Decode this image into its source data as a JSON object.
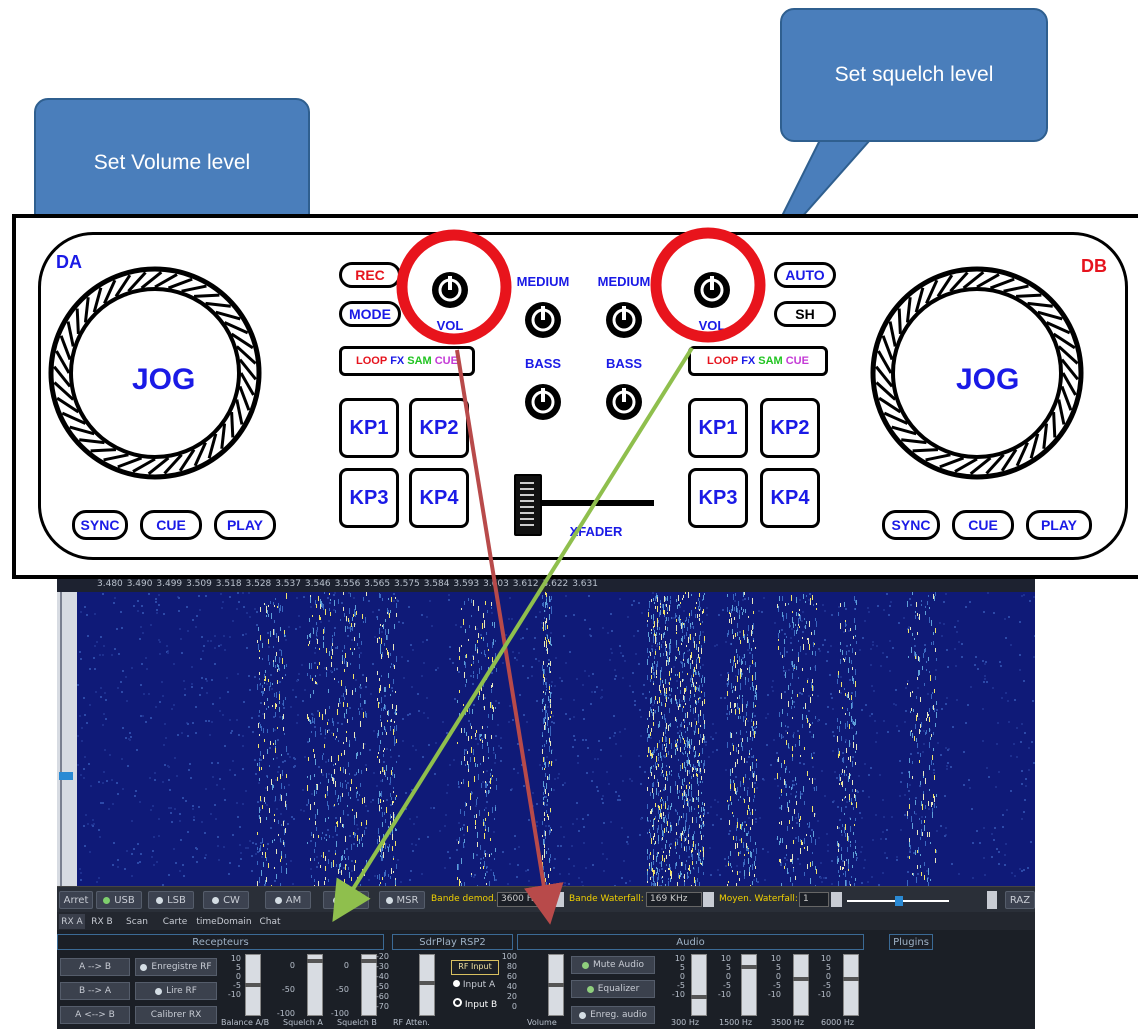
{
  "callouts": {
    "volume": "Set Volume level",
    "squelch": "Set squelch level"
  },
  "controller": {
    "deck_a": "DA",
    "deck_b": "DB",
    "jog": "JOG",
    "left_buttons": [
      "REC",
      "MODE"
    ],
    "right_buttons": [
      "AUTO",
      "SH"
    ],
    "vol": "VOL",
    "medium": "MEDIUM",
    "bass": "BASS",
    "loop": [
      "LOOP",
      "FX",
      "SAM",
      "CUE"
    ],
    "pads": [
      "KP1",
      "KP2",
      "KP3",
      "KP4"
    ],
    "bottom_buttons": [
      "SYNC",
      "CUE",
      "PLAY"
    ],
    "xfader": "XFADER",
    "colors": {
      "label": "#1a1ae6",
      "rec": "#e6141e",
      "db": "#e6141e",
      "fx": "#1a1ae6",
      "sam": "#21c421",
      "cue": "#c43ad6",
      "highlight_circle": "#e8141c",
      "arrow_red": "#b84a4a",
      "arrow_green": "#8fbf4d"
    }
  },
  "sdr": {
    "ruler_ticks": [
      "3.480",
      "3.490",
      "3.499",
      "3.509",
      "3.518",
      "3.528",
      "3.537",
      "3.546",
      "3.556",
      "3.565",
      "3.575",
      "3.584",
      "3.593",
      "3.603",
      "3.612",
      "3.622",
      "3.631"
    ],
    "mode_buttons": {
      "stop": "Arret",
      "usb": "USB",
      "lsb": "LSB",
      "cw": "CW",
      "am": "AM",
      "fm": "FM",
      "msr": "MSR"
    },
    "demod": {
      "label": "Bande demod.:",
      "value": "3600 Hz"
    },
    "waterfall_band": {
      "label": "Bande Waterfall:",
      "value": "169 KHz"
    },
    "waterfall_avg": {
      "label": "Moyen. Waterfall:",
      "value": "1"
    },
    "raz": "RAZ",
    "tabs": [
      "RX A",
      "RX B",
      "Scan",
      "Carte",
      "timeDomain",
      "Chat"
    ],
    "sections": {
      "receivers": "Recepteurs",
      "device": "SdrPlay RSP2",
      "audio": "Audio",
      "plugins": "Plugins"
    },
    "receiver_buttons": [
      "A --> B",
      "B --> A",
      "A <--> B"
    ],
    "rf_buttons": {
      "record": "Enregistre RF",
      "read": "Lire RF",
      "calibrate": "Calibrer RX"
    },
    "rf_input": {
      "title": "RF Input",
      "a": "Input A",
      "b": "Input B"
    },
    "audio_buttons": {
      "mute": "Mute Audio",
      "eq": "Equalizer",
      "record": "Enreg. audio"
    },
    "sliders": {
      "balance": {
        "label": "Balance A/B",
        "scale": [
          "10",
          "5",
          "0",
          "-5",
          "-10"
        ]
      },
      "squelch_a": {
        "label": "Squelch A",
        "scale": [
          "0",
          "-50",
          "-100"
        ]
      },
      "squelch_b": {
        "label": "Squelch B",
        "scale": [
          "0",
          "-50",
          "-100"
        ]
      },
      "rf_atten": {
        "label": "RF Atten.",
        "scale": [
          "-20",
          "-30",
          "-40",
          "-50",
          "-60",
          "-70"
        ]
      },
      "volume": {
        "label": "Volume",
        "scale": [
          "100",
          "80",
          "60",
          "40",
          "20",
          "0"
        ]
      },
      "eq300": {
        "label": "300 Hz",
        "scale": [
          "10",
          "5",
          "0",
          "-5",
          "-10"
        ]
      },
      "eq1500": {
        "label": "1500 Hz",
        "scale": [
          "10",
          "5",
          "0",
          "-5",
          "-10"
        ]
      },
      "eq3500": {
        "label": "3500 Hz",
        "scale": [
          "10",
          "5",
          "0",
          "-5",
          "-10"
        ]
      },
      "eq6000": {
        "label": "6000 Hz",
        "scale": [
          "10",
          "5",
          "0",
          "-5",
          "-10"
        ]
      }
    }
  }
}
